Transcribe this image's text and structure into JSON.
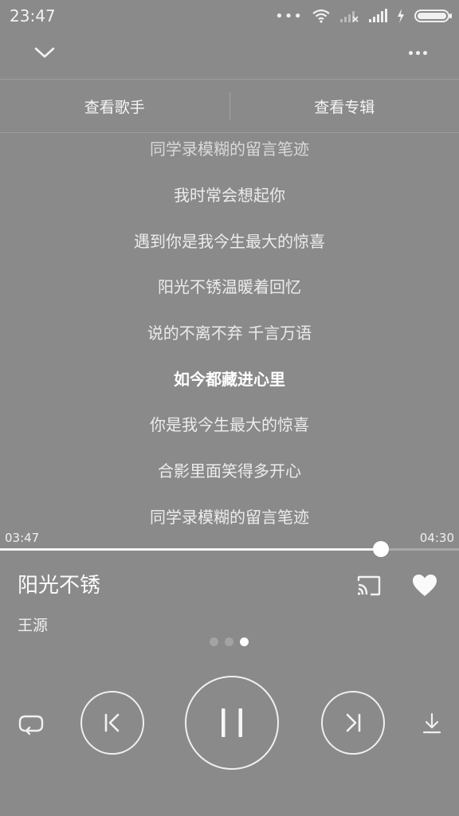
{
  "status_bar": {
    "time": "23:47",
    "battery_level": 1.0
  },
  "tabs": {
    "artist_label": "查看歌手",
    "album_label": "查看专辑"
  },
  "lyrics": {
    "lines": [
      {
        "text": "同学录模糊的留言笔迹",
        "state": "faded"
      },
      {
        "text": "我时常会想起你",
        "state": "normal"
      },
      {
        "text": "遇到你是我今生最大的惊喜",
        "state": "normal"
      },
      {
        "text": "阳光不锈温暖着回忆",
        "state": "normal"
      },
      {
        "text": "说的不离不弃 千言万语",
        "state": "normal"
      },
      {
        "text": "如今都藏进心里",
        "state": "active"
      },
      {
        "text": "你是我今生最大的惊喜",
        "state": "normal"
      },
      {
        "text": "合影里面笑得多开心",
        "state": "normal"
      },
      {
        "text": "同学录模糊的留言笔迹",
        "state": "normal"
      }
    ]
  },
  "player": {
    "current_time": "03:47",
    "total_time": "04:30",
    "progress": 0.83,
    "song_title": "阳光不锈",
    "artist": "王源",
    "page_count": 3,
    "active_page": 2
  },
  "icons": {
    "collapse": "chevron-down-icon",
    "more": "more-dots-icon",
    "cast": "cast-icon",
    "favorite": "heart-icon",
    "repeat": "repeat-icon",
    "previous": "skip-previous-icon",
    "pause": "pause-icon",
    "next": "skip-next-icon",
    "download": "download-icon"
  },
  "colors": {
    "background": "#8a8a8a",
    "foreground": "#ffffff"
  }
}
